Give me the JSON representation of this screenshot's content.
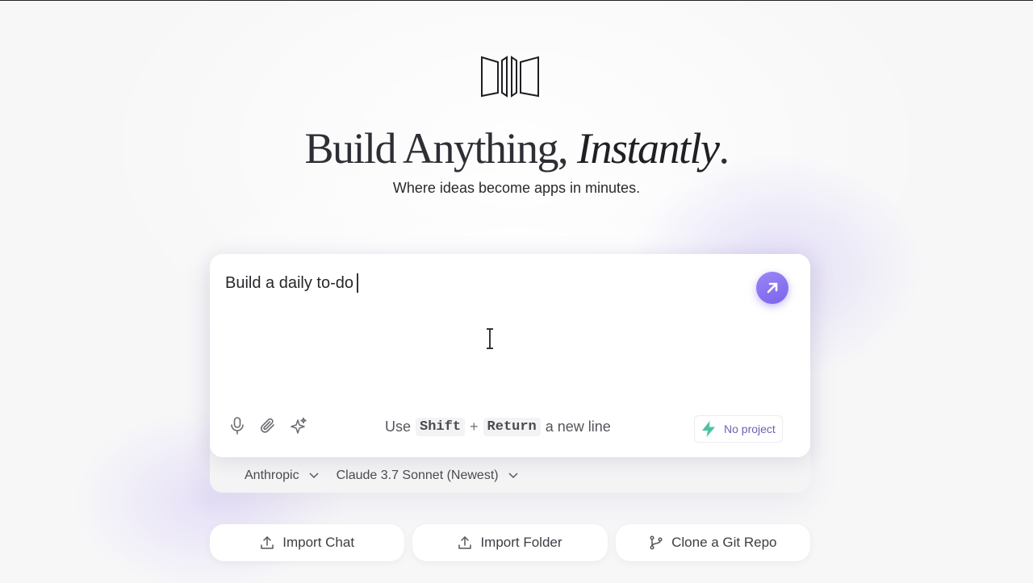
{
  "hero": {
    "title_main": "Build Anything,",
    "title_accent": "Instantly",
    "title_period": ".",
    "subtitle": "Where ideas become apps in minutes."
  },
  "composer": {
    "value": "Build a daily to-do",
    "hint_prefix": "Use",
    "hint_key1": "Shift",
    "hint_plus": "+",
    "hint_key2": "Return",
    "hint_suffix": "a new line",
    "project_label": "No project"
  },
  "model": {
    "provider": "Anthropic",
    "model_name": "Claude 3.7 Sonnet (Newest)"
  },
  "actions": [
    {
      "label": "Import Chat",
      "icon": "upload-icon"
    },
    {
      "label": "Import Folder",
      "icon": "upload-icon"
    },
    {
      "label": "Clone a Git Repo",
      "icon": "git-branch-icon"
    }
  ],
  "colors": {
    "accent": "#8b74f0",
    "bolt": "#4cc3a0",
    "project_text": "#6d5fb5"
  }
}
